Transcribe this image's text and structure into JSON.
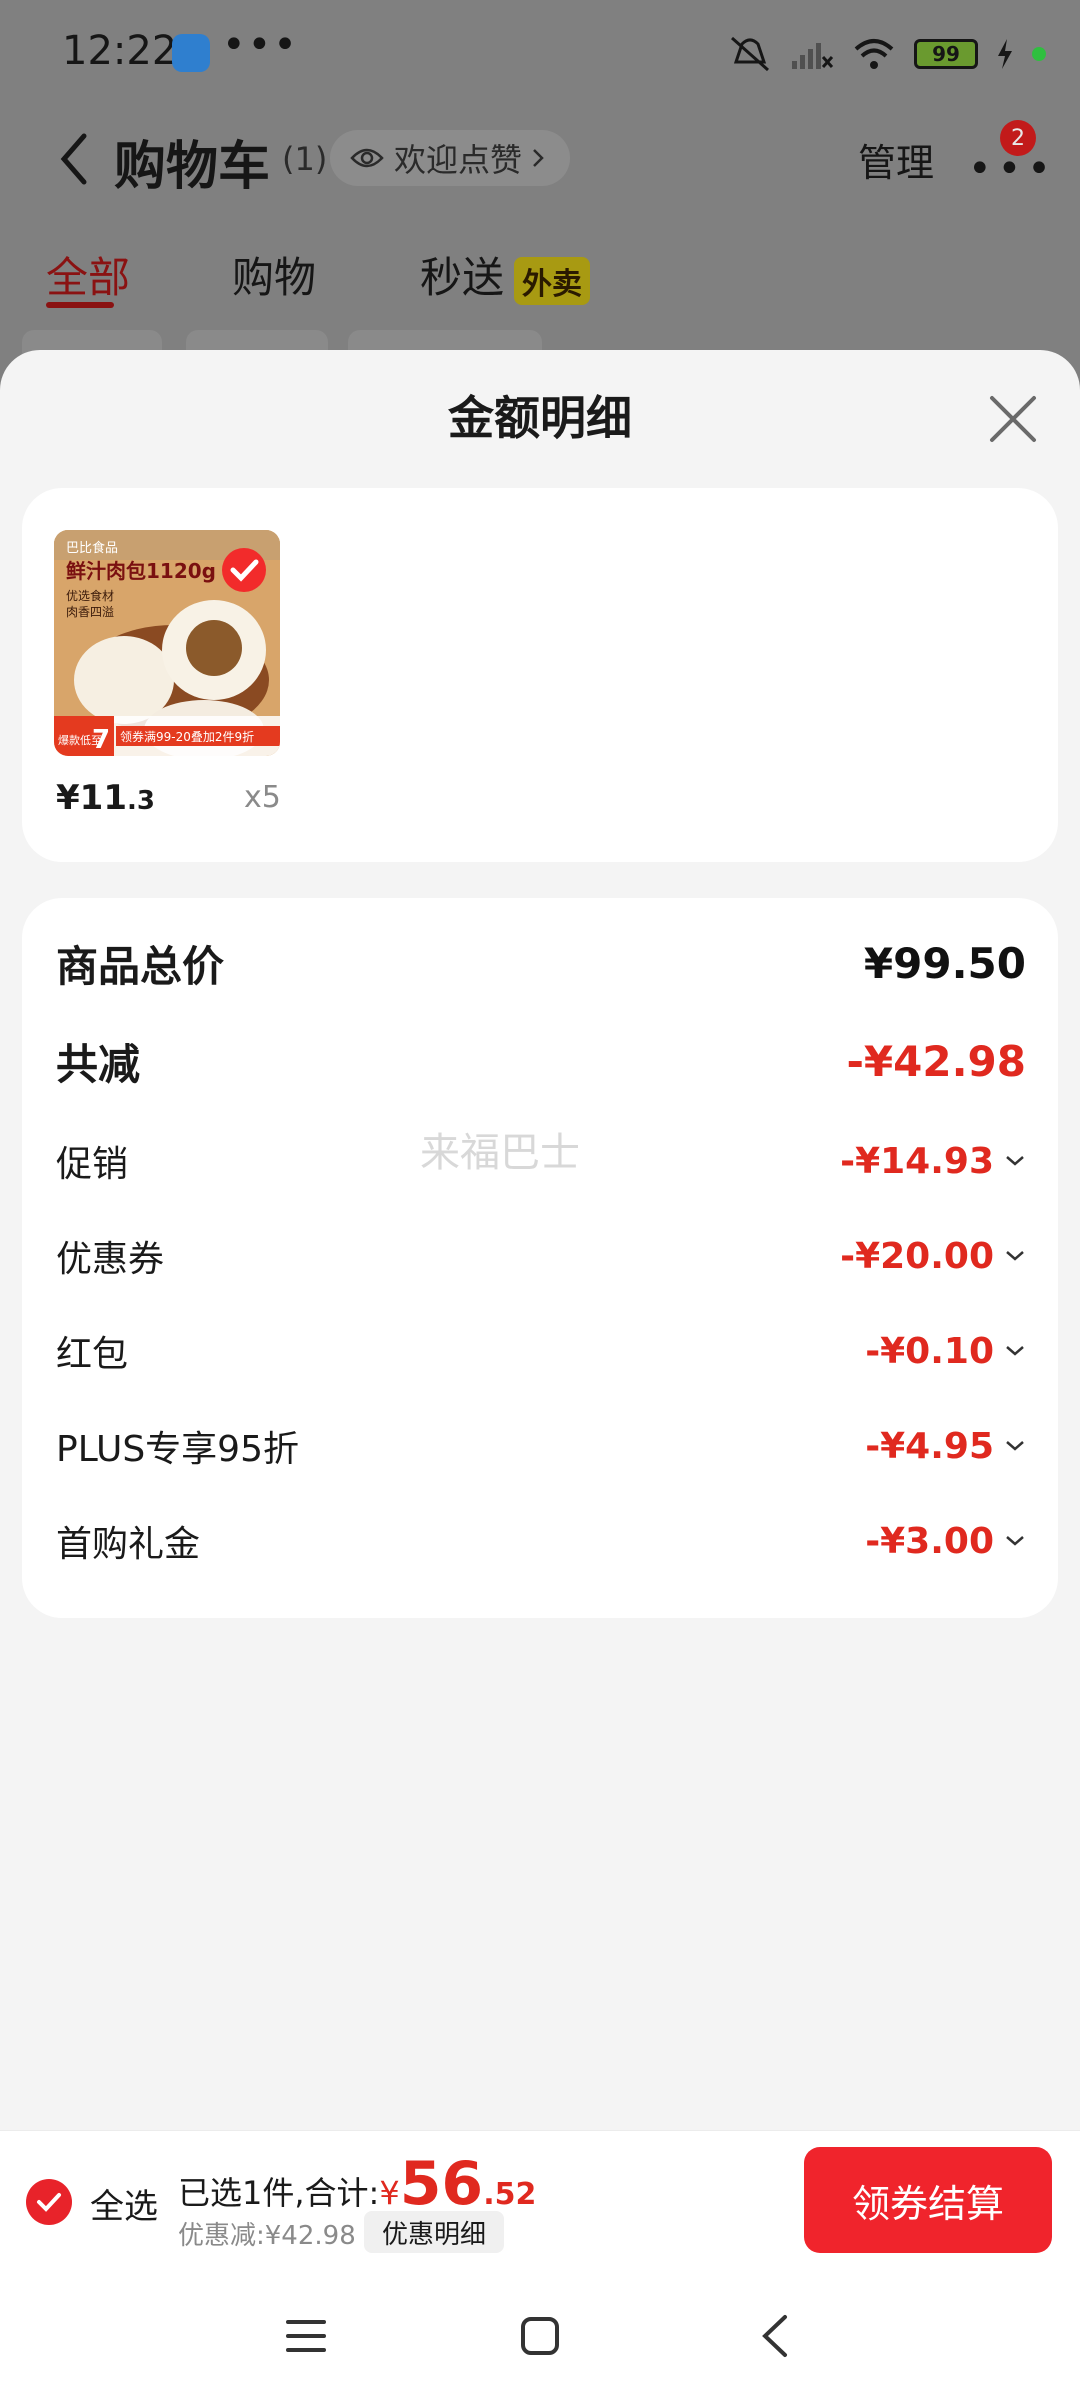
{
  "status_bar": {
    "time": "12:22",
    "dots": "•••",
    "battery": "99"
  },
  "nav": {
    "title": "购物车",
    "count": "(1)",
    "praise": "欢迎点赞",
    "manage": "管理",
    "more_badge": "2"
  },
  "tabs": [
    {
      "label": "全部"
    },
    {
      "label": "购物"
    },
    {
      "label": "秒送",
      "badge": "外卖"
    }
  ],
  "sheet": {
    "title": "金额明细",
    "product": {
      "thumb_brand": "巴比食品",
      "thumb_title": "鲜汁肉包1120g",
      "thumb_sub1": "优选食材",
      "thumb_sub2": "肉香四溢",
      "thumb_badge_lines": "爆款低至",
      "thumb_badge_num": "7",
      "thumb_promo": "领券满99-20叠加2件9折",
      "price_int": "¥11",
      "price_dec": ".3",
      "qty": "x5"
    },
    "details": {
      "total_label": "商品总价",
      "total_value": "¥99.50",
      "reduce_label": "共减",
      "reduce_value": "-¥42.98",
      "items": [
        {
          "label": "促销",
          "value": "-¥14.93"
        },
        {
          "label": "优惠券",
          "value": "-¥20.00"
        },
        {
          "label": "红包",
          "value": "-¥0.10"
        },
        {
          "label": "PLUS专享95折",
          "value": "-¥4.95"
        },
        {
          "label": "首购礼金",
          "value": "-¥3.00"
        }
      ]
    },
    "watermark": "来福巴士"
  },
  "checkout": {
    "select_all": "全选",
    "summary_prefix": "已选1件,合计:",
    "currency": "¥",
    "total_int": "56",
    "total_dec": ".52",
    "discount": "优惠减:¥42.98",
    "detail_button": "优惠明细",
    "pay_button": "领券结算"
  },
  "colors": {
    "accent": "#f0242c",
    "price_red": "#e0291f"
  }
}
